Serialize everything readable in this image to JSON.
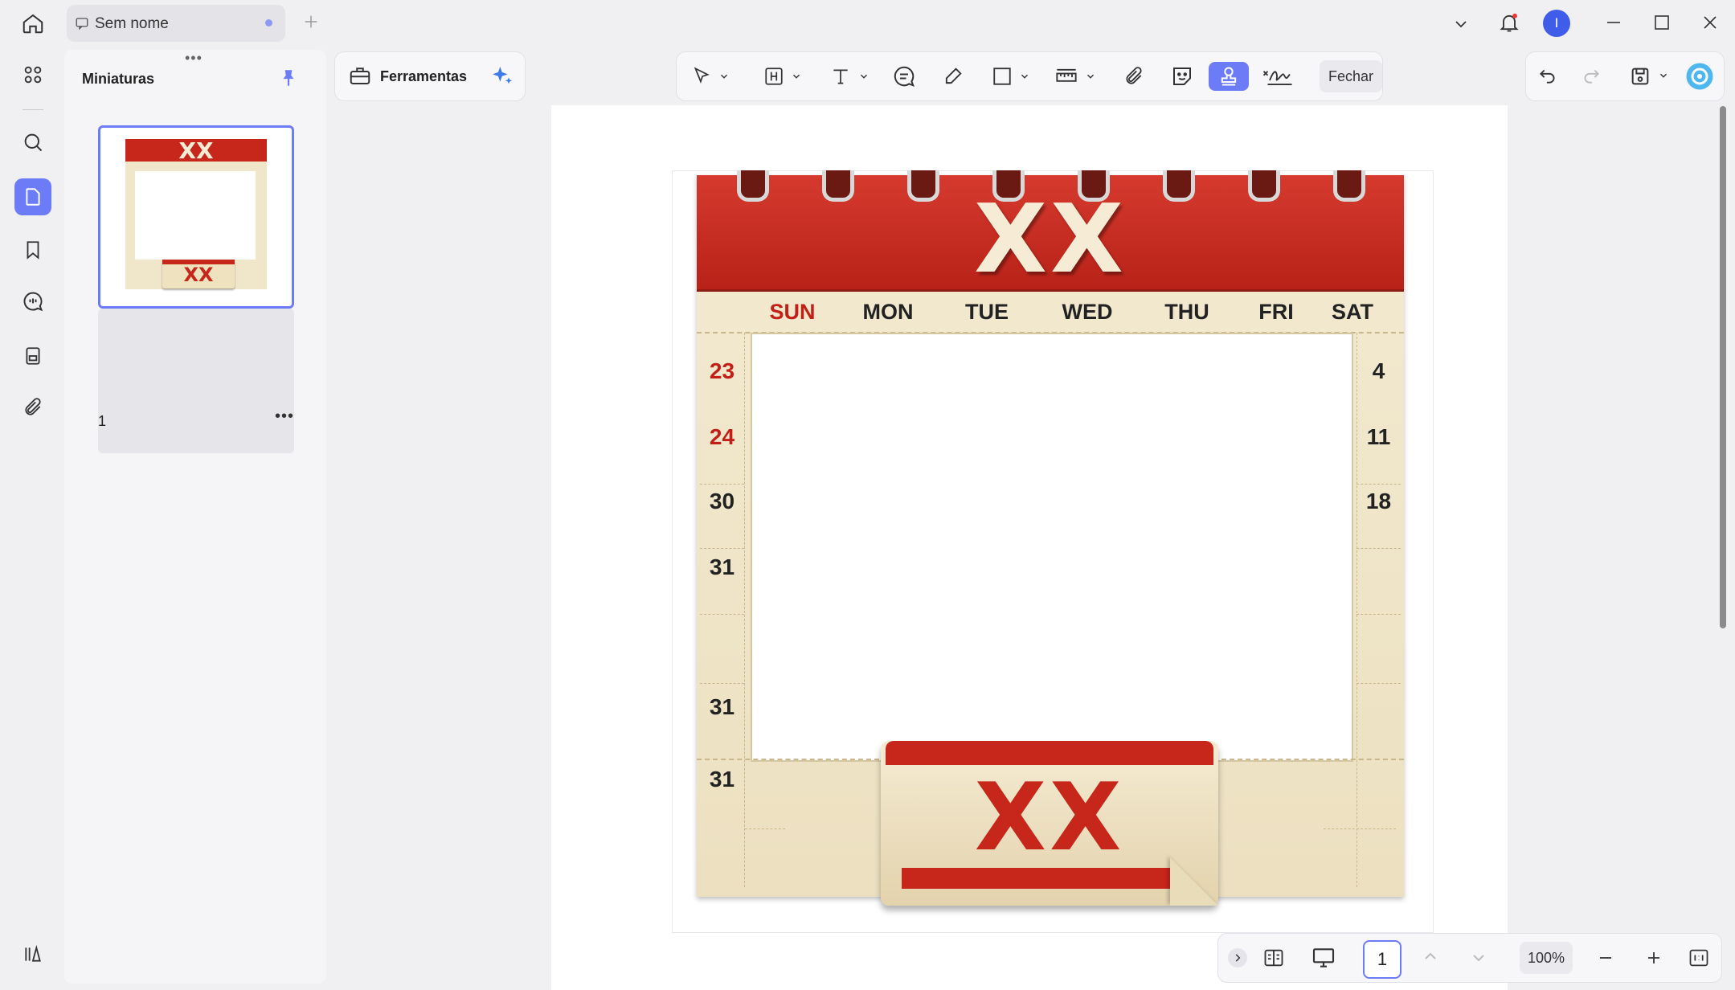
{
  "window": {
    "tab_title": "Sem nome"
  },
  "sidebar_panel": {
    "title": "Miniaturas",
    "grip": "•••",
    "thumbnail_page_number": "1",
    "thumbnail_more": "•••"
  },
  "toolbar": {
    "tools_label": "Ferramentas",
    "close_label": "Fechar"
  },
  "calendar": {
    "header_title": "XX",
    "weekdays": [
      "SUN",
      "MON",
      "TUE",
      "WED",
      "THU",
      "FRI",
      "SAT"
    ],
    "left_days": [
      "23",
      "24",
      "30",
      "31",
      "31",
      "31"
    ],
    "right_days": [
      "4",
      "11",
      "18"
    ],
    "tag_title": "XX"
  },
  "statusbar": {
    "page_number": "1",
    "zoom": "100%"
  },
  "colors": {
    "accent": "#6b7cf6",
    "calendar_red": "#c7261b",
    "calendar_cream": "#f3ead1"
  }
}
